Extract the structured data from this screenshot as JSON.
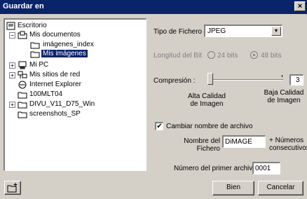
{
  "window": {
    "title": "Guardar en",
    "close_glyph": "×"
  },
  "tree": {
    "items": [
      {
        "label": "Escritorio",
        "icon": "desktop-icon"
      },
      {
        "label": "Mis documentos",
        "icon": "documents-folder-icon",
        "expander": "−"
      },
      {
        "label": "imágenes_index",
        "icon": "folder-icon"
      },
      {
        "label": "Mis imágenes",
        "icon": "folder-icon",
        "selected": true
      },
      {
        "label": "Mi PC",
        "icon": "computer-icon",
        "expander": "+"
      },
      {
        "label": "Mis sitios de red",
        "icon": "network-icon",
        "expander": "+"
      },
      {
        "label": "Internet Explorer",
        "icon": "internet-explorer-icon"
      },
      {
        "label": "100MLT04",
        "icon": "folder-icon"
      },
      {
        "label": "DIVU_V11_D75_Win",
        "icon": "folder-icon",
        "expander": "+"
      },
      {
        "label": "screenshots_SP",
        "icon": "folder-icon"
      }
    ]
  },
  "filetype": {
    "label": "Tipo de Fichero",
    "value": "JPEG"
  },
  "bitdepth": {
    "label": "Longitud del Bit",
    "opt1": "24 bits",
    "opt2": "48 bits",
    "selected": "48 bits"
  },
  "compression": {
    "label": "Compresión :",
    "value": "3",
    "low_label_1": "Alta Calidad",
    "low_label_2": "de Imagen",
    "high_label_1": "Baja Calidad",
    "high_label_2": "de Imagen"
  },
  "rename": {
    "checkbox_label": "Cambiar nombre de archivo",
    "checked": true,
    "check_glyph": "✔",
    "name_label_1": "Nombre del",
    "name_label_2": "Fichero",
    "name_value": "DiMAGE",
    "suffix_1": "+ Números",
    "suffix_2": "consecutivos",
    "first_label": "Número del primer archivo",
    "first_value": "0001"
  },
  "buttons": {
    "ok": "Bien",
    "cancel": "Cancelar"
  }
}
